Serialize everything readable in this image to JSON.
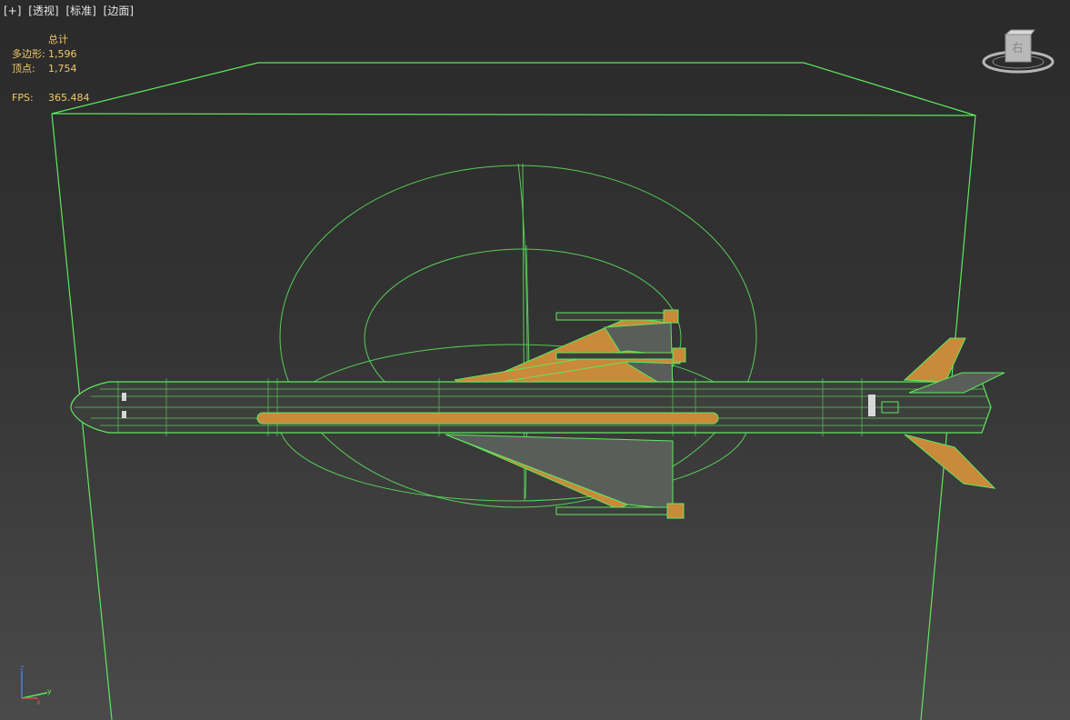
{
  "viewport": {
    "labels": [
      "[+]",
      "[透视]",
      "[标准]",
      "[边面]"
    ]
  },
  "stats": {
    "header": "总计",
    "polygons_label": "多边形:",
    "polygons_value": "1,596",
    "vertices_label": "顶点:",
    "vertices_value": "1,754",
    "fps_label": "FPS:",
    "fps_value": "365.484"
  },
  "viewcube": {
    "face_label": "右"
  },
  "axis_gizmo": {
    "labels": [
      "z",
      "y",
      "x"
    ]
  },
  "colors": {
    "wire_green": "#5ee85e",
    "stat_yellow": "#f0c96a",
    "missile_body": "#3c3f3c",
    "fin_orange": "#c98a3a"
  }
}
